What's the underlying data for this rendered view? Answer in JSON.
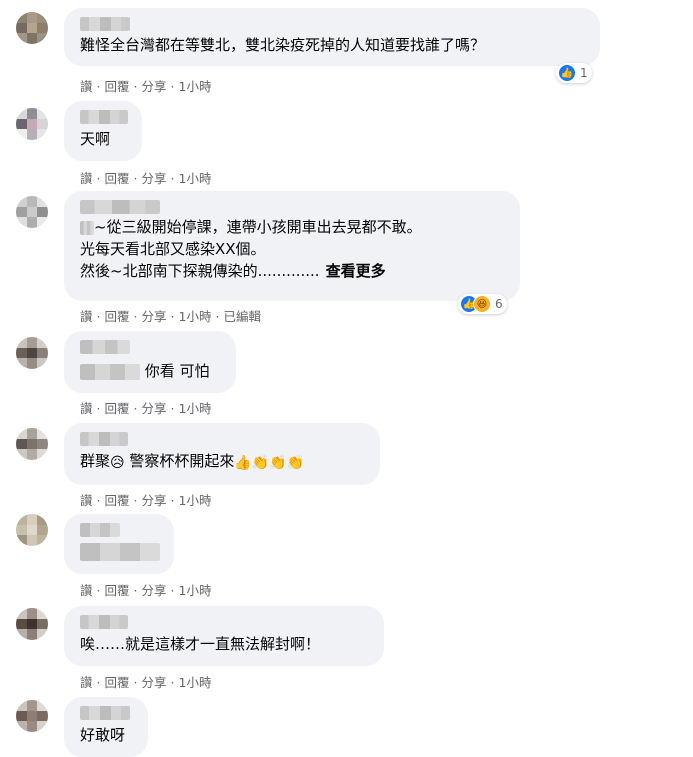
{
  "actions": {
    "like": "讚",
    "reply": "回覆",
    "share": "分享",
    "separator": "·",
    "edited": "已編輯"
  },
  "comments": [
    {
      "text": "難怪全台灣都在等雙北，雙北染疫死掉的人知道要找誰了嗎？",
      "time": "1小時",
      "reaction_count": "1"
    },
    {
      "text": "天啊",
      "time": "1小時"
    },
    {
      "line1": "~從三級開始停課，連帶小孩開車出去晃都不敢。",
      "line2": "光每天看北部又感染XX個。",
      "line3": "然後~北部南下探親傳染的.............",
      "see_more": "查看更多",
      "time": "1小時",
      "reaction_count": "6"
    },
    {
      "text": "你看 可怕",
      "time": "1小時"
    },
    {
      "text_a": "群聚",
      "text_b": "警察杯杯開起來",
      "emoji_a": "😥",
      "emoji_b": "👍👏👏👏",
      "time": "1小時"
    },
    {
      "time": "1小時"
    },
    {
      "text": "唉……就是這樣才一直無法解封啊！",
      "time": "1小時"
    },
    {
      "text": "好敢呀"
    }
  ],
  "colors": {
    "bubble": "#f0f2f5",
    "meta": "#65676b",
    "like_blue": "#1877f2",
    "text": "#050505"
  }
}
